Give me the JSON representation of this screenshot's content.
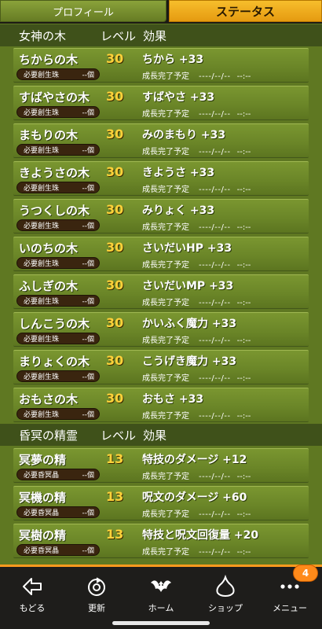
{
  "tabs": {
    "profile": "プロフィール",
    "status": "ステータス"
  },
  "sections": [
    {
      "header": {
        "name": "女神の木",
        "level": "レベル",
        "effect": "効果"
      },
      "rows": [
        {
          "name": "ちからの木",
          "level": "30",
          "effect": "ちから +33",
          "req_label": "必要創生珠",
          "req_value": "--個",
          "complete_label": "成長完了予定",
          "date": "----/--/--",
          "time": "--:--"
        },
        {
          "name": "すばやさの木",
          "level": "30",
          "effect": "すばやさ +33",
          "req_label": "必要創生珠",
          "req_value": "--個",
          "complete_label": "成長完了予定",
          "date": "----/--/--",
          "time": "--:--"
        },
        {
          "name": "まもりの木",
          "level": "30",
          "effect": "みのまもり +33",
          "req_label": "必要創生珠",
          "req_value": "--個",
          "complete_label": "成長完了予定",
          "date": "----/--/--",
          "time": "--:--"
        },
        {
          "name": "きようさの木",
          "level": "30",
          "effect": "きようさ +33",
          "req_label": "必要創生珠",
          "req_value": "--個",
          "complete_label": "成長完了予定",
          "date": "----/--/--",
          "time": "--:--"
        },
        {
          "name": "うつくしの木",
          "level": "30",
          "effect": "みりょく +33",
          "req_label": "必要創生珠",
          "req_value": "--個",
          "complete_label": "成長完了予定",
          "date": "----/--/--",
          "time": "--:--"
        },
        {
          "name": "いのちの木",
          "level": "30",
          "effect": "さいだいHP +33",
          "req_label": "必要創生珠",
          "req_value": "--個",
          "complete_label": "成長完了予定",
          "date": "----/--/--",
          "time": "--:--"
        },
        {
          "name": "ふしぎの木",
          "level": "30",
          "effect": "さいだいMP +33",
          "req_label": "必要創生珠",
          "req_value": "--個",
          "complete_label": "成長完了予定",
          "date": "----/--/--",
          "time": "--:--"
        },
        {
          "name": "しんこうの木",
          "level": "30",
          "effect": "かいふく魔力 +33",
          "req_label": "必要創生珠",
          "req_value": "--個",
          "complete_label": "成長完了予定",
          "date": "----/--/--",
          "time": "--:--"
        },
        {
          "name": "まりょくの木",
          "level": "30",
          "effect": "こうげき魔力 +33",
          "req_label": "必要創生珠",
          "req_value": "--個",
          "complete_label": "成長完了予定",
          "date": "----/--/--",
          "time": "--:--"
        },
        {
          "name": "おもさの木",
          "level": "30",
          "effect": "おもさ +33",
          "req_label": "必要創生珠",
          "req_value": "--個",
          "complete_label": "成長完了予定",
          "date": "----/--/--",
          "time": "--:--"
        }
      ]
    },
    {
      "header": {
        "name": "昏冥の精霊",
        "level": "レベル",
        "effect": "効果"
      },
      "rows": [
        {
          "name": "冥夢の精",
          "level": "13",
          "effect": "特技のダメージ +12",
          "req_label": "必要昏冥晶",
          "req_value": "--個",
          "complete_label": "成長完了予定",
          "date": "----/--/--",
          "time": "--:--"
        },
        {
          "name": "冥機の精",
          "level": "13",
          "effect": "呪文のダメージ +60",
          "req_label": "必要昏冥晶",
          "req_value": "--個",
          "complete_label": "成長完了予定",
          "date": "----/--/--",
          "time": "--:--"
        },
        {
          "name": "冥樹の精",
          "level": "13",
          "effect": "特技と呪文回復量 +20",
          "req_label": "必要昏冥晶",
          "req_value": "--個",
          "complete_label": "成長完了予定",
          "date": "----/--/--",
          "time": "--:--"
        }
      ]
    }
  ],
  "nav": [
    {
      "label": "もどる",
      "icon": "back-arrow-icon"
    },
    {
      "label": "更新",
      "icon": "refresh-icon"
    },
    {
      "label": "ホーム",
      "icon": "dragon-icon"
    },
    {
      "label": "ショップ",
      "icon": "slime-icon"
    },
    {
      "label": "メニュー",
      "icon": "more-dots-icon"
    }
  ],
  "menu_badge": "4",
  "colors": {
    "accent": "#ff9a1e",
    "level": "#ffd23a",
    "panel": "#6b8628",
    "tab_active": "#f2ad1f"
  }
}
